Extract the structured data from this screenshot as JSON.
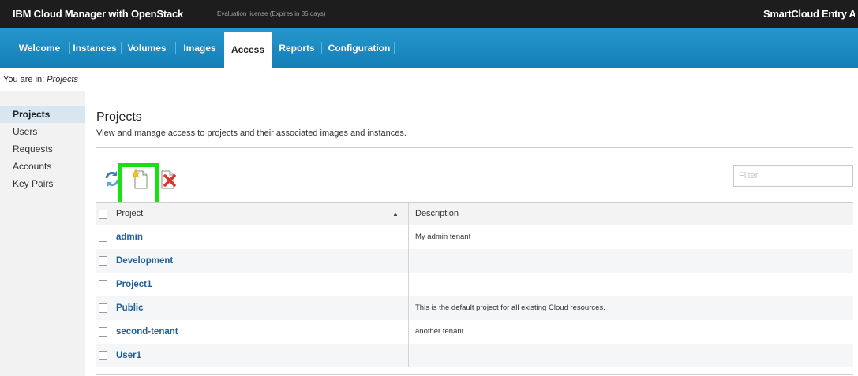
{
  "header": {
    "title": "IBM Cloud Manager with OpenStack",
    "license": "Evaluation license (Expires in 85 days)",
    "brand": "SmartCloud Entry Administrator"
  },
  "nav": {
    "items": [
      {
        "label": "Welcome"
      },
      {
        "label": "Instances"
      },
      {
        "label": "Volumes"
      },
      {
        "label": "Images"
      },
      {
        "label": "Access",
        "active": true
      },
      {
        "label": "Reports"
      },
      {
        "label": "Configuration"
      }
    ]
  },
  "breadcrumb": {
    "prefix": "You are in:",
    "current": "Projects"
  },
  "sidebar": {
    "items": [
      {
        "label": "Projects",
        "active": true
      },
      {
        "label": "Users"
      },
      {
        "label": "Requests"
      },
      {
        "label": "Accounts"
      },
      {
        "label": "Key Pairs"
      }
    ]
  },
  "main": {
    "title": "Projects",
    "description": "View and manage access to projects and their associated images and instances.",
    "toolbar": {
      "refresh_icon": "refresh-icon",
      "new_icon": "new-project-icon",
      "delete_icon": "delete-icon"
    },
    "filter_placeholder": "Filter"
  },
  "table": {
    "columns": [
      "Project",
      "Description"
    ],
    "sort_indicator": "▲",
    "rows": [
      {
        "project": "admin",
        "description": "My admin tenant"
      },
      {
        "project": "Development",
        "description": ""
      },
      {
        "project": "Project1",
        "description": ""
      },
      {
        "project": "Public",
        "description": "This is the default project for all existing Cloud resources."
      },
      {
        "project": "second-tenant",
        "description": "another tenant"
      },
      {
        "project": "User1",
        "description": ""
      }
    ]
  },
  "colors": {
    "topbar": "#1d1d1d",
    "navbar": "#1b8fc5",
    "link": "#1f5f99",
    "highlight": "#19e00f"
  }
}
